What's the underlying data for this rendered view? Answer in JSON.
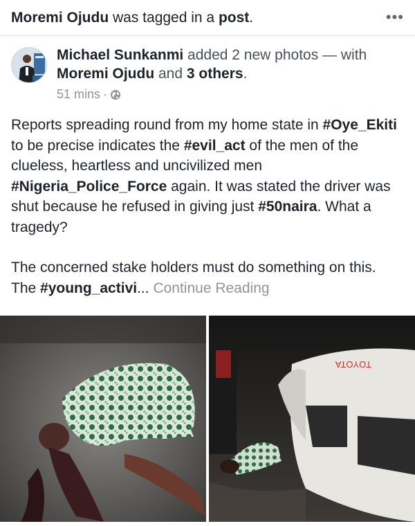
{
  "header": {
    "actor": "Moremi Ojudu",
    "text_middle": " was tagged in a ",
    "object": "post",
    "text_end": ".",
    "more_label": "•••"
  },
  "post": {
    "author": "Michael Sunkanmi",
    "action": " added 2 new photos — with ",
    "with_person": "Moremi Ojudu",
    "and_text": " and ",
    "others": "3 others",
    "period": ".",
    "time": "51 mins",
    "sep": "·",
    "privacy_icon": "globe-icon",
    "body": {
      "p1_a": "Reports spreading round from my home state in ",
      "tag_oye": "#Oye_Ekiti",
      "p1_b": " to be precise indicates the ",
      "tag_evil": "#evil_act",
      "p1_c": " of the men of the clueless, heartless and uncivilized men ",
      "tag_police": "#Nigeria_Police_Force",
      "p1_d": " again. It was stated the driver was shut because he refused in giving just ",
      "tag_naira": "#50naira",
      "p1_e": ". What a tragedy?",
      "p2": "The concerned stake holders must do something on this.",
      "p3_a": "The ",
      "tag_young": "#young_activi",
      "ellipsis": "...",
      "continue": " Continue Reading"
    }
  },
  "photos": {
    "van_text": "TOYOTA"
  }
}
